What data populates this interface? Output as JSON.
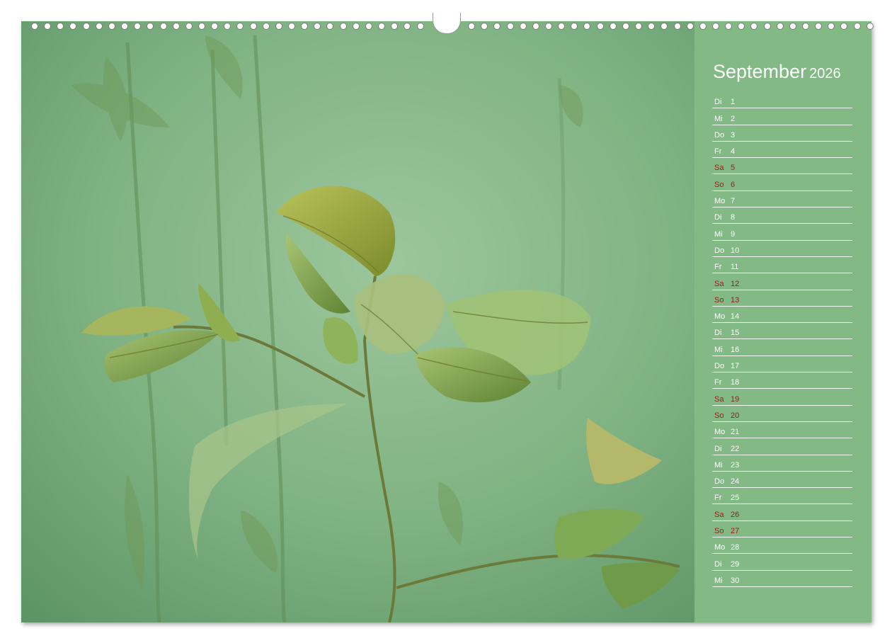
{
  "calendar": {
    "month": "September",
    "year": "2026",
    "days": [
      {
        "dn": "Di",
        "dd": "1",
        "weekend": false
      },
      {
        "dn": "Mi",
        "dd": "2",
        "weekend": false
      },
      {
        "dn": "Do",
        "dd": "3",
        "weekend": false
      },
      {
        "dn": "Fr",
        "dd": "4",
        "weekend": false
      },
      {
        "dn": "Sa",
        "dd": "5",
        "weekend": true
      },
      {
        "dn": "So",
        "dd": "6",
        "weekend": true
      },
      {
        "dn": "Mo",
        "dd": "7",
        "weekend": false
      },
      {
        "dn": "Di",
        "dd": "8",
        "weekend": false
      },
      {
        "dn": "Mi",
        "dd": "9",
        "weekend": false
      },
      {
        "dn": "Do",
        "dd": "10",
        "weekend": false
      },
      {
        "dn": "Fr",
        "dd": "11",
        "weekend": false
      },
      {
        "dn": "Sa",
        "dd": "12",
        "weekend": true
      },
      {
        "dn": "So",
        "dd": "13",
        "weekend": true
      },
      {
        "dn": "Mo",
        "dd": "14",
        "weekend": false
      },
      {
        "dn": "Di",
        "dd": "15",
        "weekend": false
      },
      {
        "dn": "Mi",
        "dd": "16",
        "weekend": false
      },
      {
        "dn": "Do",
        "dd": "17",
        "weekend": false
      },
      {
        "dn": "Fr",
        "dd": "18",
        "weekend": false
      },
      {
        "dn": "Sa",
        "dd": "19",
        "weekend": true
      },
      {
        "dn": "So",
        "dd": "20",
        "weekend": true
      },
      {
        "dn": "Mo",
        "dd": "21",
        "weekend": false
      },
      {
        "dn": "Di",
        "dd": "22",
        "weekend": false
      },
      {
        "dn": "Mi",
        "dd": "23",
        "weekend": false
      },
      {
        "dn": "Do",
        "dd": "24",
        "weekend": false
      },
      {
        "dn": "Fr",
        "dd": "25",
        "weekend": false
      },
      {
        "dn": "Sa",
        "dd": "26",
        "weekend": true
      },
      {
        "dn": "So",
        "dd": "27",
        "weekend": true
      },
      {
        "dn": "Mo",
        "dd": "28",
        "weekend": false
      },
      {
        "dn": "Di",
        "dd": "29",
        "weekend": false
      },
      {
        "dn": "Mi",
        "dd": "30",
        "weekend": false
      }
    ]
  },
  "colors": {
    "panel": "#82b985",
    "weekday_text": "#ffffff",
    "weekend_text": "#a3191c"
  },
  "photo": {
    "subject": "underwater-plant-photo"
  }
}
